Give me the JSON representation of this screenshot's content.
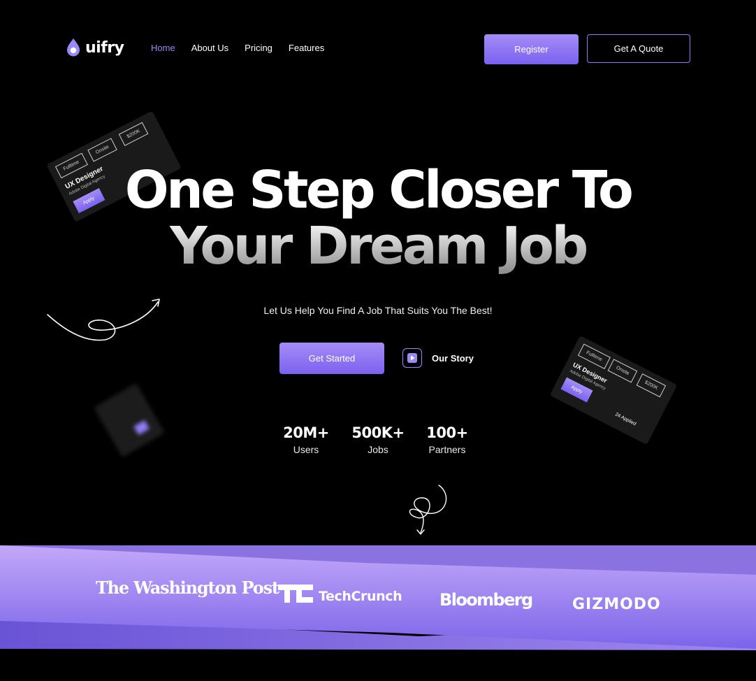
{
  "brand": {
    "name": "uifry"
  },
  "nav": {
    "items": [
      {
        "label": "Home",
        "active": true
      },
      {
        "label": "About Us",
        "active": false
      },
      {
        "label": "Pricing",
        "active": false
      },
      {
        "label": "Features",
        "active": false
      }
    ],
    "register_label": "Register",
    "quote_label": "Get A Quote"
  },
  "hero": {
    "line1": "One Step Closer To",
    "line2": "Your Dream Job",
    "subtitle": "Let Us Help You Find A Job That Suits You The Best!",
    "cta_label": "Get Started",
    "story_label": "Our Story"
  },
  "stats": [
    {
      "value": "20M+",
      "label": "Users"
    },
    {
      "value": "500K+",
      "label": "Jobs"
    },
    {
      "value": "100+",
      "label": "Partners"
    }
  ],
  "job_card": {
    "title": "UX Designer",
    "company": "Adobe Digital Agency",
    "tags": [
      "Fulltime",
      "Onsite",
      "$200K"
    ],
    "apply_label": "Apply",
    "applied_text": "24 Applied"
  },
  "press_logos": [
    "The Washington Post",
    "TechCrunch",
    "Bloomberg",
    "GIZMODO"
  ],
  "colors": {
    "accent": "#8f7bf3",
    "accent_light": "#a58cf7",
    "background": "#000000"
  }
}
